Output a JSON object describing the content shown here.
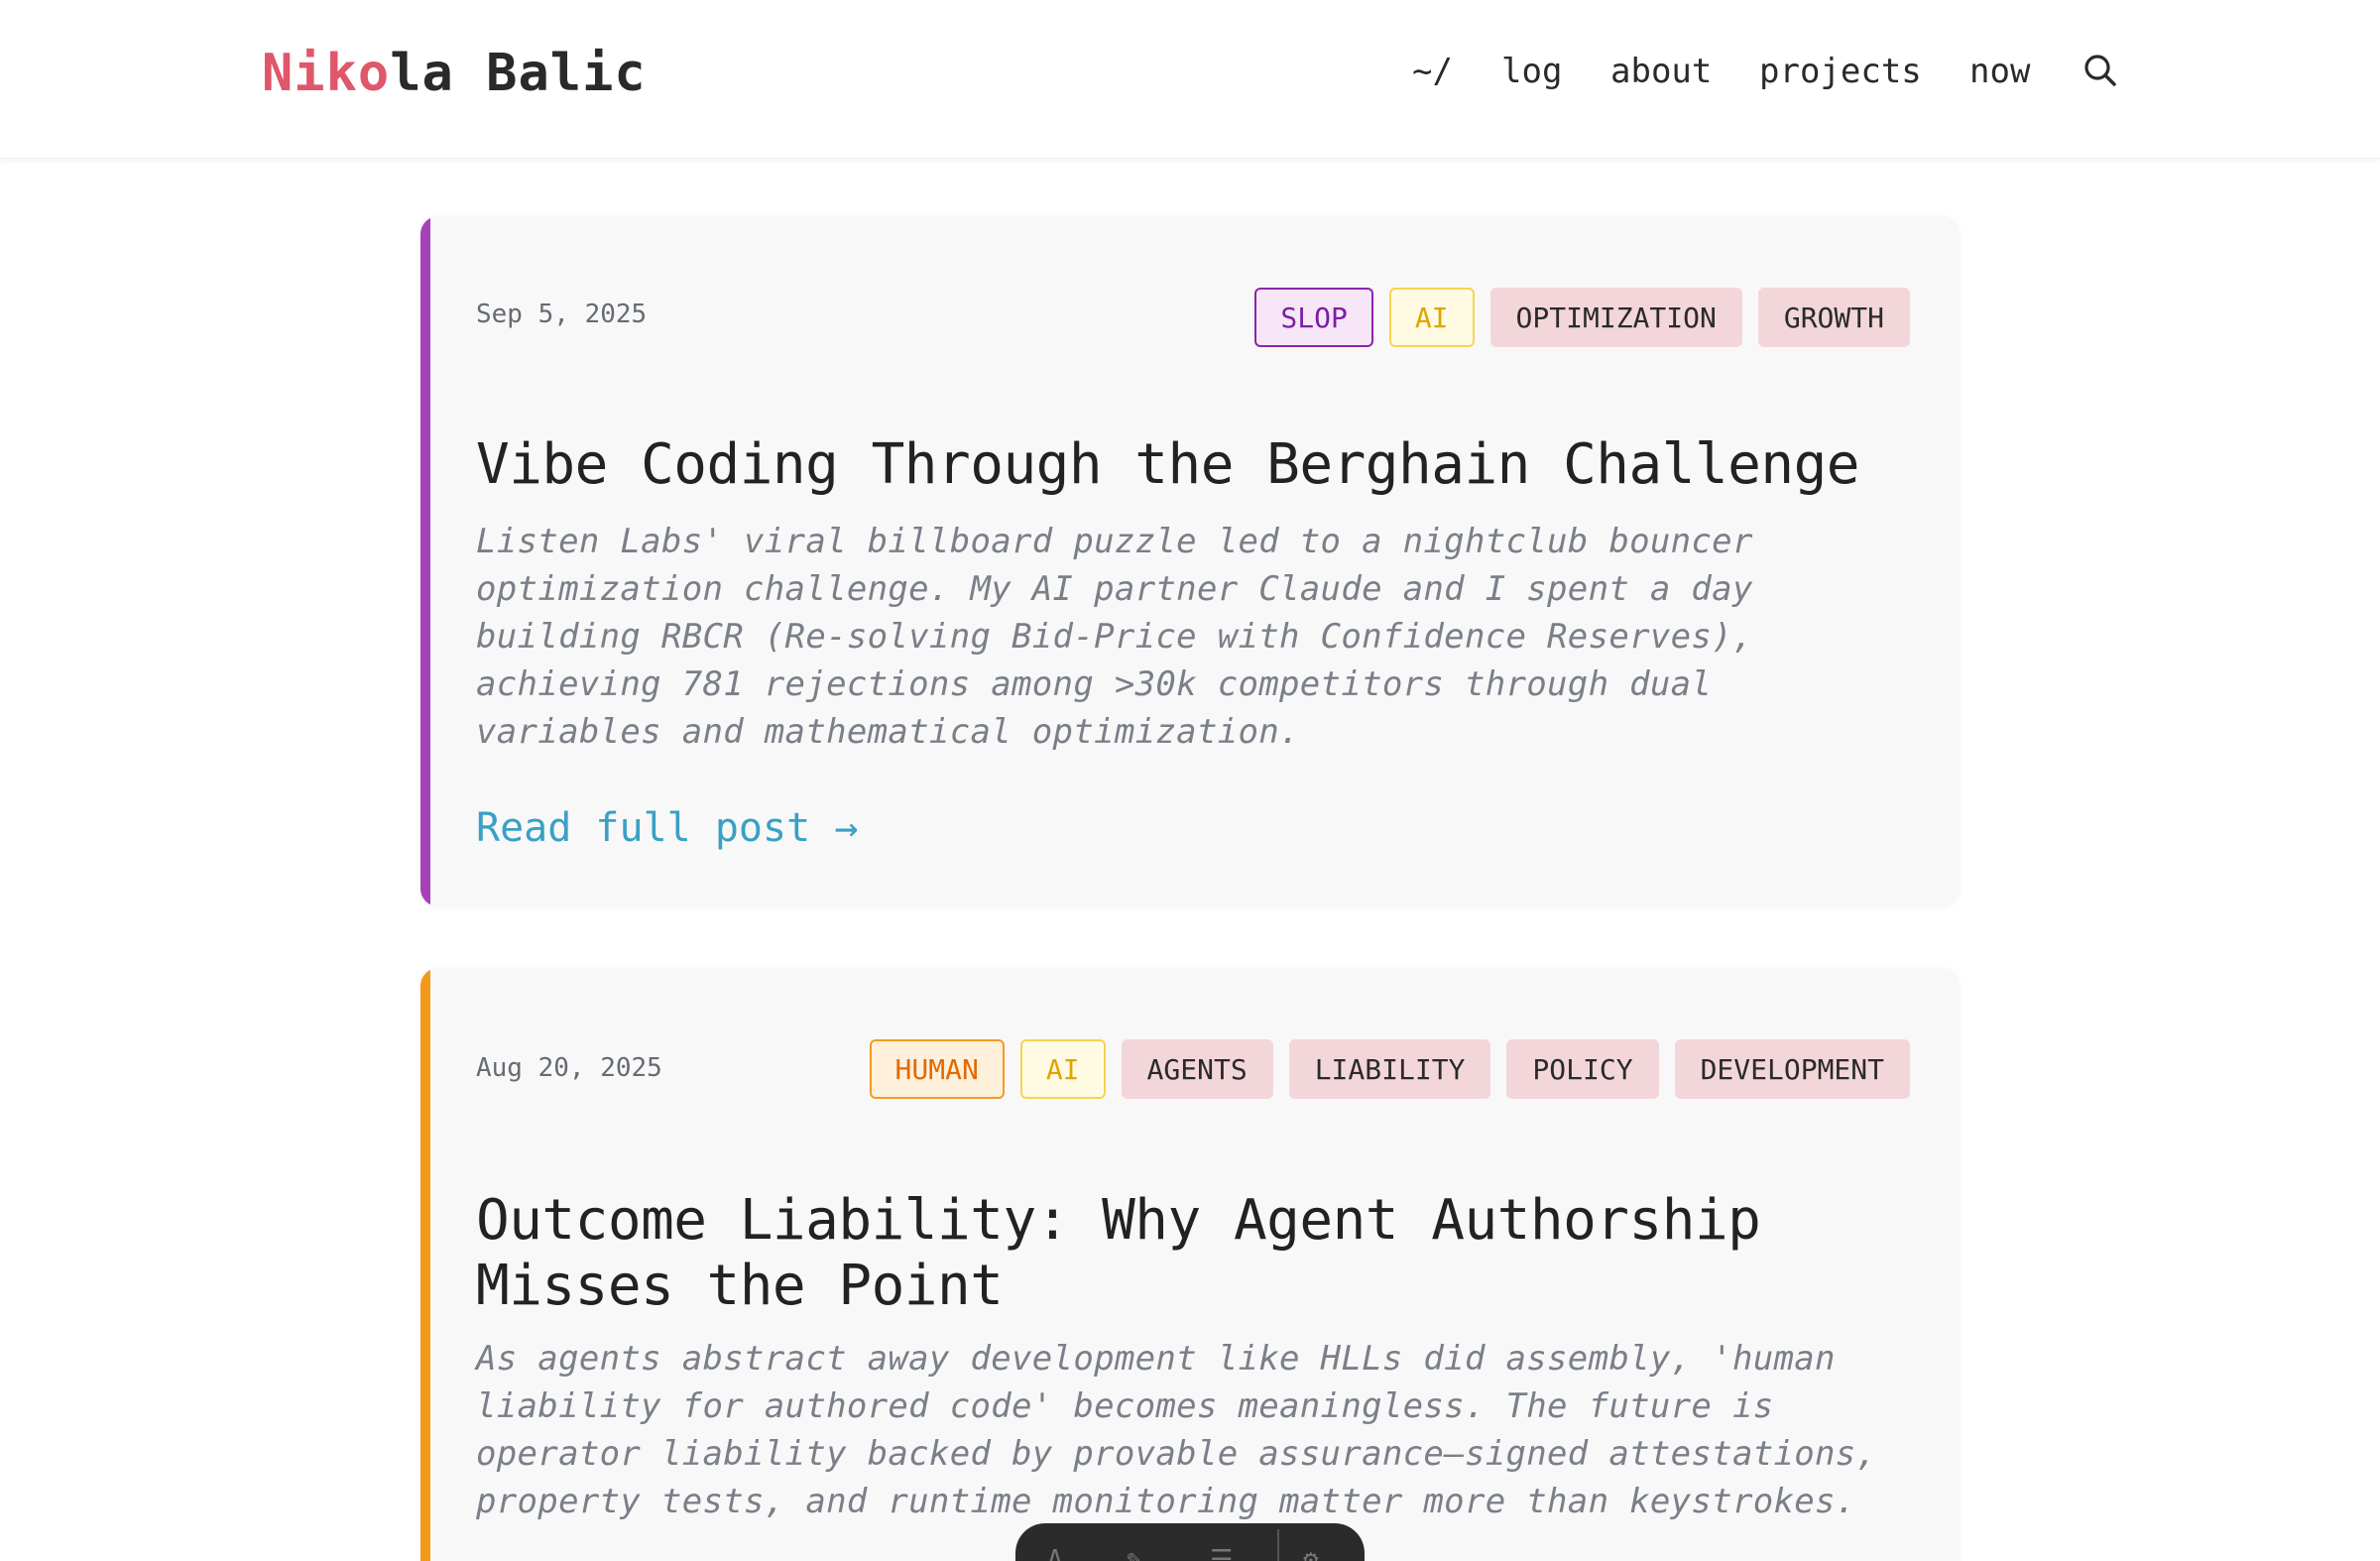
{
  "site": {
    "logo_hl": "Niko",
    "logo_rest": "la Balic"
  },
  "nav": {
    "home": "~/",
    "log": "log",
    "about": "about",
    "projects": "projects",
    "now": "now"
  },
  "posts": [
    {
      "date": "Sep 5, 2025",
      "accent": "#a542b8",
      "tags": [
        "SLOP",
        "AI",
        "OPTIMIZATION",
        "GROWTH"
      ],
      "title": "Vibe Coding Through the Berghain Challenge",
      "excerpt": "Listen Labs' viral billboard puzzle led to a nightclub bouncer optimization challenge. My AI partner Claude and I spent a day building RBCR (Re-solving Bid-Price with Confidence Reserves), achieving 781 rejections among >30k competitors through dual variables and mathematical optimization.",
      "read_more": "Read full post →"
    },
    {
      "date": "Aug 20, 2025",
      "accent": "#f39a1a",
      "tags": [
        "HUMAN",
        "AI",
        "AGENTS",
        "LIABILITY",
        "POLICY",
        "DEVELOPMENT"
      ],
      "title": "Outcome Liability: Why Agent Authorship Misses the Point",
      "excerpt": "As agents abstract away development like HLLs did assembly, 'human liability for authored code' becomes meaningless. The future is operator liability backed by provable assurance—signed attestations, property tests, and runtime monitoring matter more than keystrokes."
    }
  ],
  "colors": {
    "logo_accent": "#e0566a",
    "link": "#3aa0c4"
  }
}
